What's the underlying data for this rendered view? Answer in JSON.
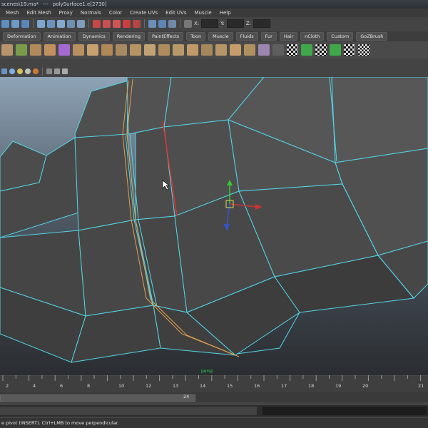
{
  "title_bar": {
    "scene_file": "scenes\\19.ma*",
    "separator": "---",
    "selection": "polySurface1.e[2730]"
  },
  "menu": [
    "Mesh",
    "Edit Mesh",
    "Proxy",
    "Normals",
    "Color",
    "Create UVs",
    "Edit UVs",
    "Muscle",
    "Help"
  ],
  "status_line": {
    "x_label": "X:",
    "y_label": "Y:",
    "z_label": "Z:"
  },
  "shelf_tabs": [
    "Deformation",
    "Animation",
    "Dynamics",
    "Rendering",
    "PaintEffects",
    "Toon",
    "Muscle",
    "Fluids",
    "Fur",
    "Hair",
    "nCloth",
    "Custom",
    "GoZBrush"
  ],
  "viewport": {
    "pivot_label": "persp"
  },
  "time_slider": {
    "ticks": [
      "2",
      "4",
      "6",
      "8",
      "10",
      "12",
      "13",
      "14",
      "15",
      "16",
      "17",
      "18",
      "19",
      "20",
      "21"
    ],
    "current_frame": "24"
  },
  "help_line": {
    "text": "e pivot (INSERT). Ctrl+LMB to move perpendicular."
  },
  "colors": {
    "wire": "#52d6e8",
    "selected_edge": "#e03030",
    "orange_edge": "#e0a050",
    "x_axis": "#cc3333",
    "y_axis": "#33cc33",
    "z_axis": "#3355cc",
    "surface": "#4a4a4a"
  }
}
